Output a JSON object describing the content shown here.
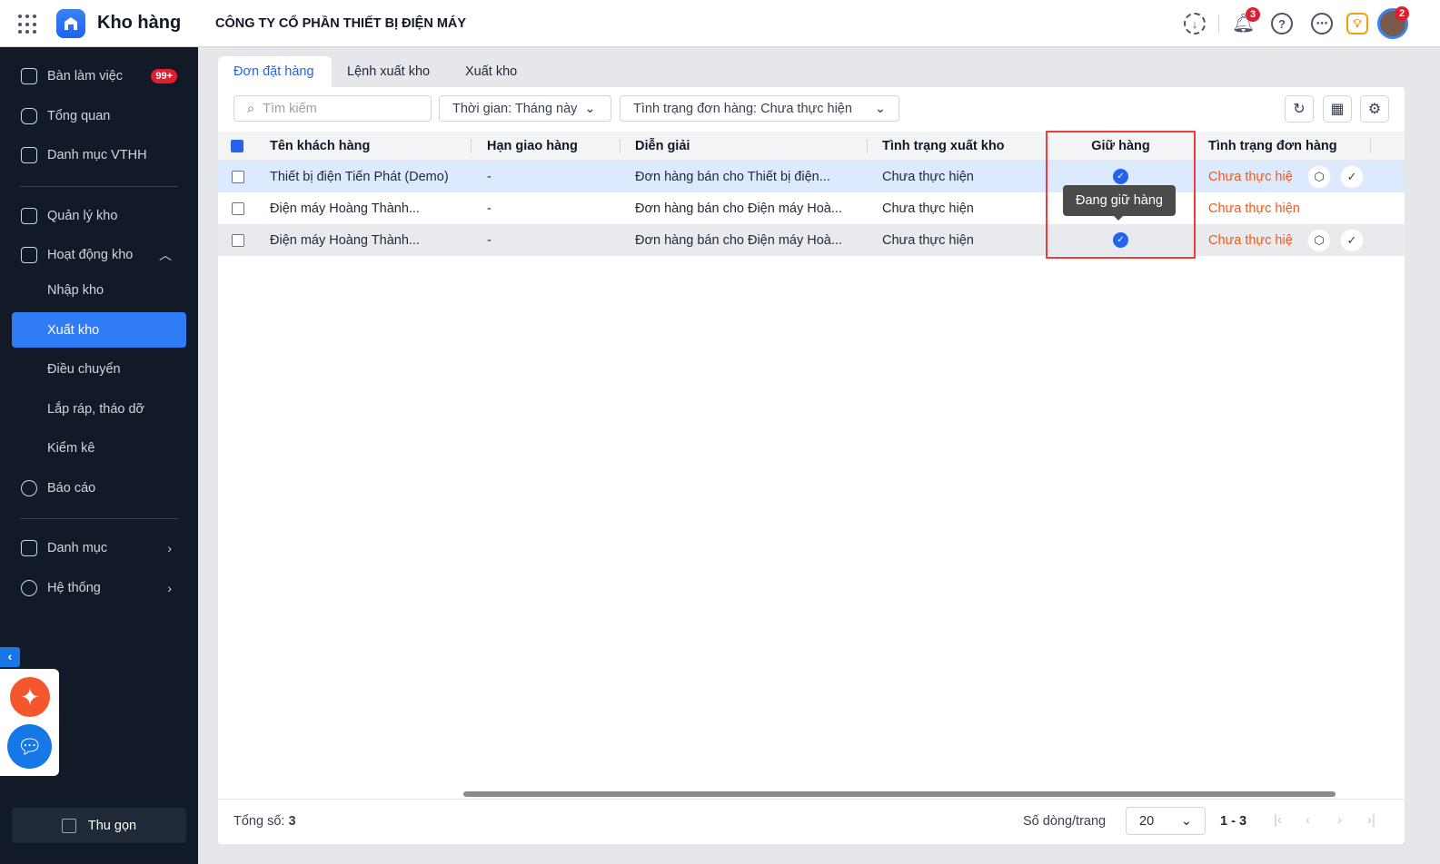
{
  "header": {
    "app_title": "Kho hàng",
    "company": "CÔNG TY CỔ PHẦN THIẾT BỊ ĐIỆN MÁY",
    "notification_count": "3",
    "avatar_badge": "2"
  },
  "sidebar": {
    "items": [
      {
        "label": "Bàn làm việc",
        "badge": "99+"
      },
      {
        "label": "Tổng quan"
      },
      {
        "label": "Danh mục VTHH"
      },
      {
        "label": "Quản lý kho"
      },
      {
        "label": "Hoạt động kho"
      },
      {
        "label": "Nhập kho"
      },
      {
        "label": "Xuất kho"
      },
      {
        "label": "Điều chuyển"
      },
      {
        "label": "Lắp ráp, tháo dỡ"
      },
      {
        "label": "Kiểm kê"
      },
      {
        "label": "Báo cáo"
      },
      {
        "label": "Danh mục"
      },
      {
        "label": "Hệ thống"
      }
    ],
    "collapse_label": "Thu gọn"
  },
  "tabs": [
    "Đơn đặt hàng",
    "Lệnh xuất kho",
    "Xuất kho"
  ],
  "toolbar": {
    "search_placeholder": "Tìm kiếm",
    "time_filter": "Thời gian: Tháng này",
    "status_filter": "Tình trạng đơn hàng: Chưa thực hiện"
  },
  "table": {
    "columns": [
      "Tên khách hàng",
      "Hạn giao hàng",
      "Diễn giải",
      "Tình trạng xuất kho",
      "Giữ hàng",
      "Tình trạng đơn hàng"
    ],
    "rows": [
      {
        "customer": "Thiết bị điện Tiến Phát (Demo)",
        "deadline": "-",
        "desc": "Đơn hàng bán cho Thiết bị điện...",
        "export_status": "Chưa thực hiện",
        "hold": true,
        "order_status": "Chưa thực hiệ"
      },
      {
        "customer": "Điện máy Hoàng Thành...",
        "deadline": "-",
        "desc": "Đơn hàng bán cho Điện máy Hoà...",
        "export_status": "Chưa thực hiện",
        "hold": false,
        "order_status": "Chưa thực hiện"
      },
      {
        "customer": "Điện máy Hoàng Thành...",
        "deadline": "-",
        "desc": "Đơn hàng bán cho Điện máy Hoà...",
        "export_status": "Chưa thực hiện",
        "hold": true,
        "order_status": "Chưa thực hiệ"
      }
    ],
    "tooltip": "Đang giữ hàng"
  },
  "footer": {
    "total_label": "Tổng số:",
    "total": "3",
    "rows_per_page_label": "Số dòng/trang",
    "rows_per_page": "20",
    "range": "1 - 3"
  }
}
